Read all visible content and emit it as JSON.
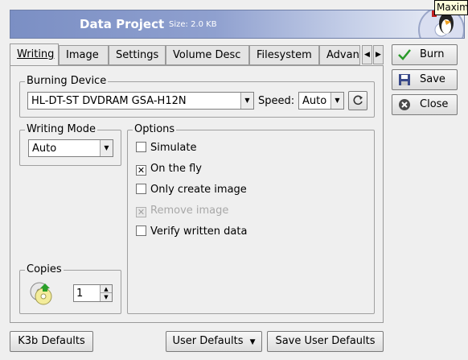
{
  "header": {
    "title": "Data Project",
    "size": "Size: 2.0 KB"
  },
  "tooltip": "Maxim",
  "tabs": [
    {
      "label": "Writing",
      "active": true
    },
    {
      "label": "Image"
    },
    {
      "label": "Settings"
    },
    {
      "label": "Volume Desc"
    },
    {
      "label": "Filesystem"
    },
    {
      "label": "Advanced"
    }
  ],
  "burning_device": {
    "legend": "Burning Device",
    "device": "HL-DT-ST DVDRAM GSA-H12N",
    "speed_label": "Speed:",
    "speed_value": "Auto"
  },
  "writing_mode": {
    "legend": "Writing Mode",
    "value": "Auto"
  },
  "options": {
    "legend": "Options",
    "items": [
      {
        "label": "Simulate",
        "checked": false
      },
      {
        "label": "On the fly",
        "checked": true
      },
      {
        "label": "Only create image",
        "checked": false
      },
      {
        "label": "Remove image",
        "checked": true,
        "disabled": true
      },
      {
        "label": "Verify written data",
        "checked": false
      }
    ]
  },
  "copies": {
    "legend": "Copies",
    "value": "1"
  },
  "side_buttons": {
    "burn": "Burn",
    "save": "Save",
    "close": "Close"
  },
  "bottom_buttons": {
    "k3b_defaults": "K3b Defaults",
    "user_defaults": "User Defaults",
    "save_user_defaults": "Save User Defaults"
  }
}
